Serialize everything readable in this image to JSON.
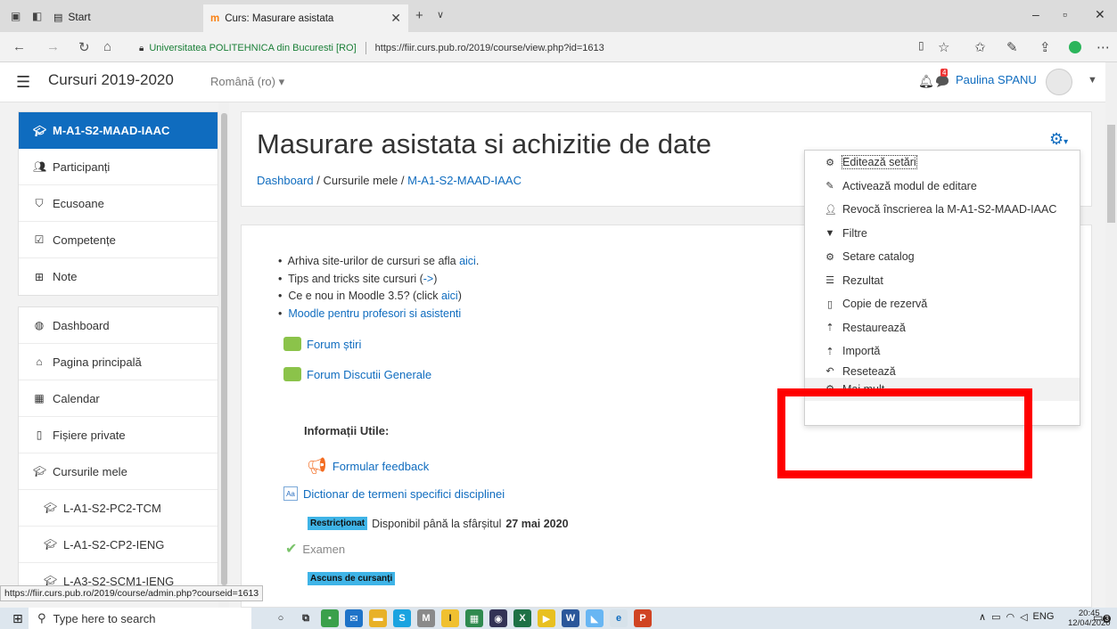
{
  "browser": {
    "start_tab": "Start",
    "active_tab": "Curs: Masurare asistata",
    "cert_label": "Universitatea POLITEHNICA din Bucuresti [RO]",
    "url": "https://fiir.curs.pub.ro/2019/course/view.php?id=1613",
    "status_url": "https://fiir.curs.pub.ro/2019/course/admin.php?courseid=1613"
  },
  "navbar": {
    "site_name": "Cursuri 2019-2020",
    "language": "Română (ro) ▾",
    "user_name": "Paulina SPANU",
    "message_count": "4"
  },
  "sidebar": {
    "course": "M-A1-S2-MAAD-IAAC",
    "course_items": [
      "Participanți",
      "Ecusoane",
      "Competențe",
      "Note"
    ],
    "nav_items": [
      "Dashboard",
      "Pagina principală",
      "Calendar",
      "Fișiere private",
      "Cursurile mele"
    ],
    "courses": [
      "L-A1-S2-PC2-TCM",
      "L-A1-S2-CP2-IENG",
      "L-A3-S2-SCM1-IENG"
    ]
  },
  "header": {
    "title": "Masurare asistata si achizitie de date",
    "breadcrumb": [
      "Dashboard",
      "Cursurile mele",
      "M-A1-S2-MAAD-IAAC"
    ]
  },
  "content": {
    "b1_text": "Arhiva site-urilor de cursuri se afla ",
    "b1_link": "aici",
    "b1_end": ".",
    "b2_text": "Tips and tricks site cursuri (",
    "b2_link": "->",
    "b2_end": ")",
    "b3_text": "Ce e nou in Moodle 3.5? (click ",
    "b3_link": "aici",
    "b3_end": ")",
    "b4_link": "Moodle pentru profesori si asistenti",
    "forum1": "Forum știri",
    "forum2": "Forum Discutii Generale",
    "info_heading": "Informații Utile:",
    "feedback": "Formular feedback",
    "dictionar": "Dictionar de termeni specifici disciplinei",
    "restr_badge": "Restricționat",
    "restr_text": "Disponibil până la sfârșitul",
    "restr_date": "27 mai 2020",
    "examen": "Examen",
    "hidden_badge": "Ascuns de cursanți"
  },
  "menu": {
    "items": [
      "Editează setări",
      "Activează modul de editare",
      "Revocă înscrierea la M-A1-S2-MAAD-IAAC",
      "Filtre",
      "Setare catalog",
      "Rezultat",
      "Copie de rezervă",
      "Restaurează",
      "Importă",
      "Resetează",
      "Mai mult..."
    ]
  },
  "taskbar": {
    "search_placeholder": "Type here to search",
    "lang": "ENG",
    "time": "20:45",
    "date": "12/04/2020",
    "notif": "3"
  },
  "colors": {
    "accent": "#0f6cbf",
    "highlight_box": "#ff0000",
    "badge": "#3fb4e7"
  }
}
